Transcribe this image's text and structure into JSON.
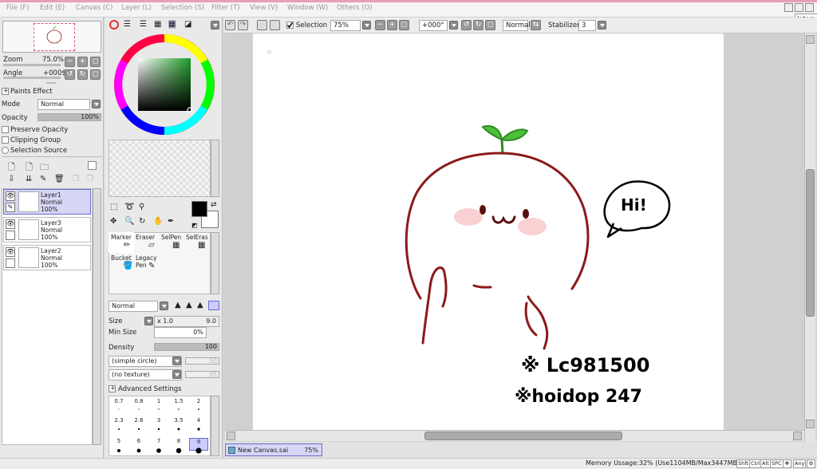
{
  "menu": [
    "File (F)",
    "Edit (E)",
    "Canvas (C)",
    "Layer (L)",
    "Selection (S)",
    "Filter (T)",
    "View (V)",
    "Window (W)",
    "Others (O)"
  ],
  "tooltip": "Intern",
  "toolbar": {
    "selection_label": "Selection",
    "zoom_value": "75%",
    "rotation_value": "+000°",
    "blend_value": "Normal",
    "stabilizer_label": "Stabilizer",
    "stabilizer_value": "3"
  },
  "navigator": {
    "zoom_label": "Zoom",
    "zoom_value": "75.0%",
    "angle_label": "Angle",
    "angle_value": "+000$"
  },
  "paints_effect": "Paints Effect",
  "layer_props": {
    "mode_label": "Mode",
    "mode_value": "Normal",
    "opacity_label": "Opacity",
    "opacity_value": "100%",
    "preserve_opacity": "Preserve Opacity",
    "clipping_group": "Clipping Group",
    "selection_source": "Selection Source"
  },
  "layers": [
    {
      "name": "Layer1",
      "mode": "Normal",
      "opacity": "100%"
    },
    {
      "name": "Layer3",
      "mode": "Normal",
      "opacity": "100%"
    },
    {
      "name": "Layer2",
      "mode": "Normal",
      "opacity": "100%"
    }
  ],
  "tools": {
    "marker": "Marker",
    "eraser": "Eraser",
    "selpen": "SelPen",
    "seleras": "SelEras",
    "bucket": "Bucket",
    "legacy1": "Legacy",
    "legacy2": "Pen"
  },
  "brush": {
    "blend_value": "Normal",
    "size_label": "Size",
    "size_mult": "x 1.0",
    "size_value": "9.0",
    "min_size_label": "Min Size",
    "min_size_value": "0%",
    "density_label": "Density",
    "density_value": "100",
    "shape_value": "(simple circle)",
    "shape_num": "50",
    "texture_value": "(no texture)",
    "texture_num": "95",
    "advanced": "Advanced Settings",
    "sizes": [
      "0.7",
      "0.8",
      "1",
      "1.5",
      "2",
      "2.3",
      "2.6",
      "3",
      "3.5",
      "4",
      "5",
      "6",
      "7",
      "8",
      "9"
    ]
  },
  "colors": {
    "primary": "#000000",
    "outline": "#8b1a1a",
    "leaf": "#4fbf3a",
    "blush": "#f7c5c8",
    "accent": "#6a6ad0"
  },
  "canvas_text": {
    "speech": "Hi!",
    "sign1": "※ Lc981500",
    "sign2": "※hoidop 247"
  },
  "document": {
    "name": "New Canvas.sai",
    "zoom": "75%"
  },
  "status": {
    "memory": "Memory Ussage:32% (Use1104MB/Max3447MB)",
    "keys": [
      "Shft",
      "Ctrl",
      "Alt",
      "SPC",
      "Any"
    ]
  }
}
